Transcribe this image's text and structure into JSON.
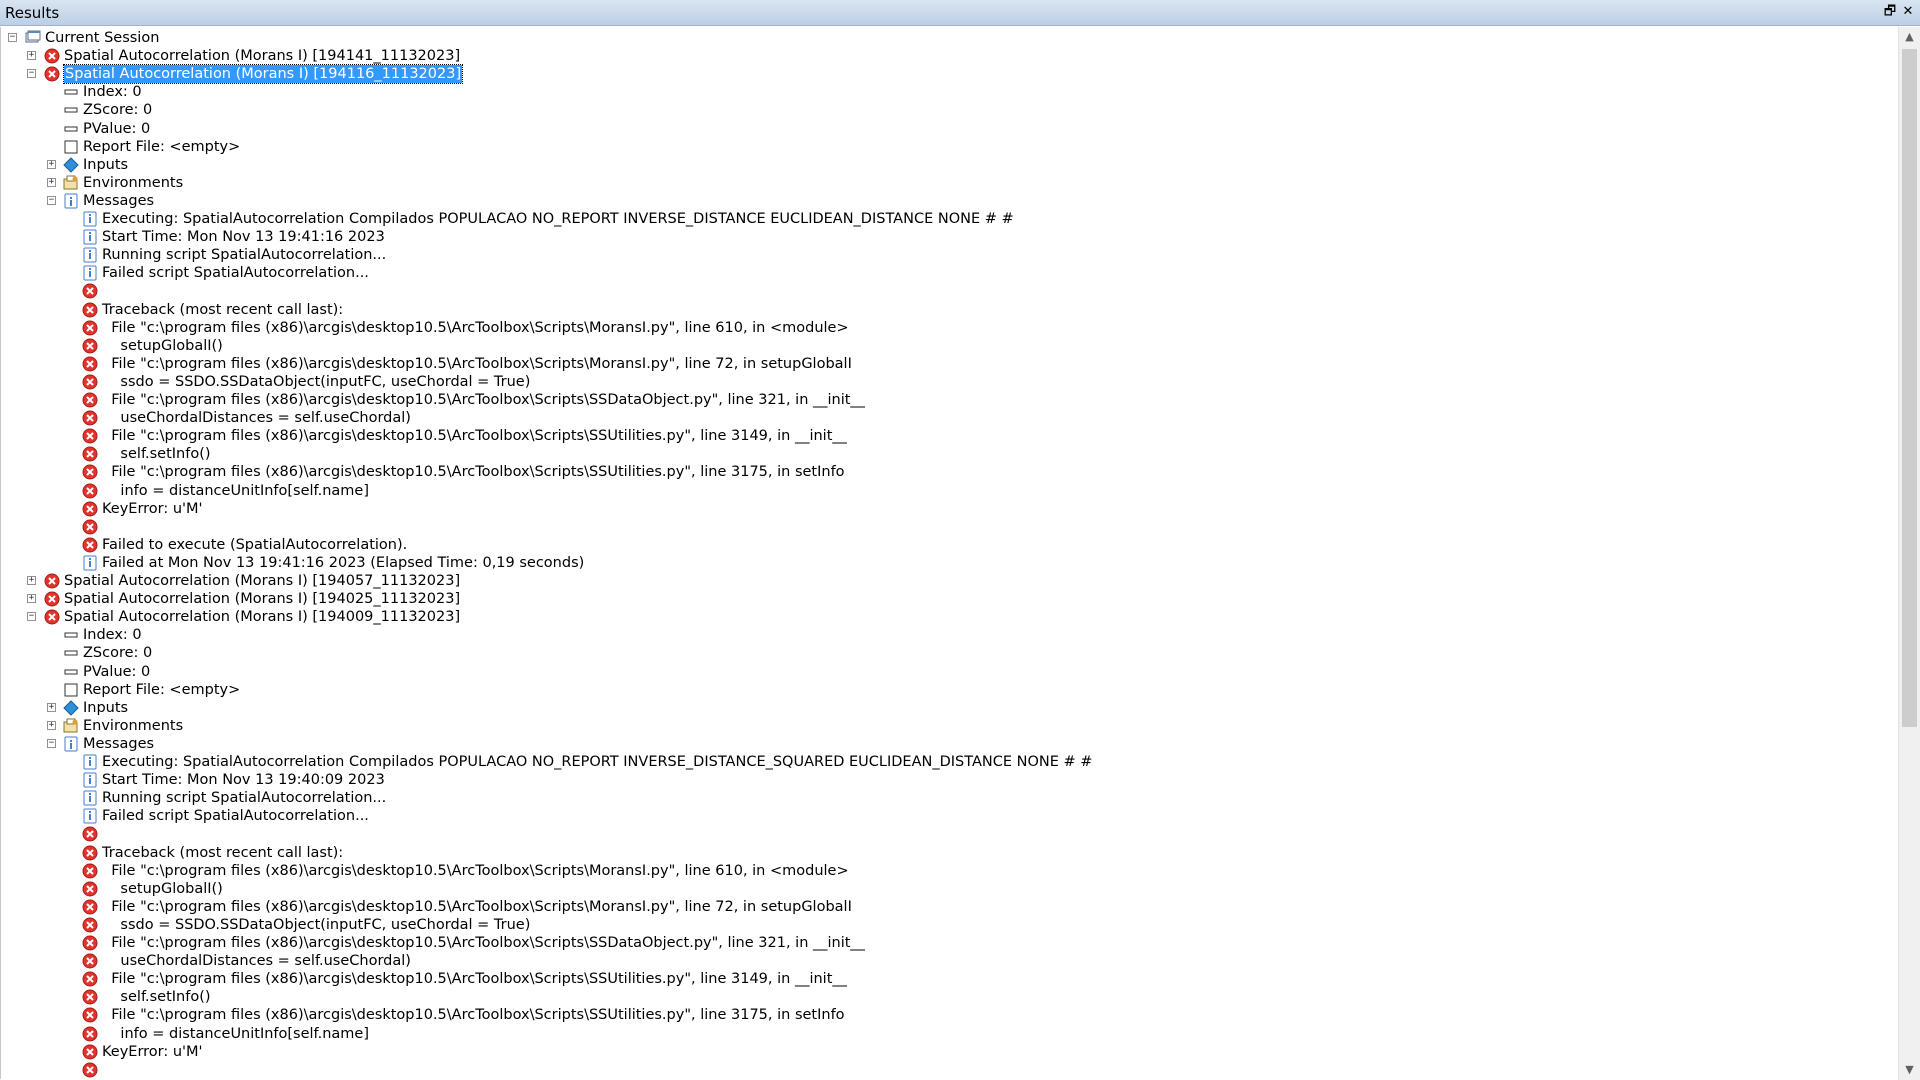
{
  "window": {
    "title": "Results"
  },
  "tree": [
    {
      "text": "Current Session",
      "depth": 0,
      "exp": "-",
      "icon": "session-icon"
    },
    {
      "text": "Spatial Autocorrelation (Morans I) [194141_11132023]",
      "depth": 1,
      "exp": "+",
      "icon": "error-icon"
    },
    {
      "text": "Spatial Autocorrelation (Morans I) [194116_11132023]",
      "depth": 1,
      "exp": "-",
      "icon": "error-icon",
      "selected": true
    },
    {
      "text": "Index: 0",
      "depth": 2,
      "icon": "value-icon"
    },
    {
      "text": "ZScore: 0",
      "depth": 2,
      "icon": "value-icon"
    },
    {
      "text": "PValue: 0",
      "depth": 2,
      "icon": "value-icon"
    },
    {
      "text": "Report File: <empty>",
      "depth": 2,
      "icon": "file-icon"
    },
    {
      "text": "Inputs",
      "depth": 2,
      "exp": "+",
      "icon": "inputs-icon"
    },
    {
      "text": "Environments",
      "depth": 2,
      "exp": "+",
      "icon": "environments-icon"
    },
    {
      "text": "Messages",
      "depth": 2,
      "exp": "-",
      "icon": "messages-icon"
    },
    {
      "text": "Executing: SpatialAutocorrelation Compilados POPULACAO NO_REPORT INVERSE_DISTANCE EUCLIDEAN_DISTANCE NONE # #",
      "depth": 3,
      "icon": "info-icon"
    },
    {
      "text": "Start Time: Mon Nov 13 19:41:16 2023",
      "depth": 3,
      "icon": "info-icon"
    },
    {
      "text": "Running script SpatialAutocorrelation...",
      "depth": 3,
      "icon": "info-icon"
    },
    {
      "text": "Failed script SpatialAutocorrelation...",
      "depth": 3,
      "icon": "info-icon"
    },
    {
      "text": "",
      "depth": 3,
      "icon": "error-icon"
    },
    {
      "text": "Traceback (most recent call last):",
      "depth": 3,
      "icon": "error-icon"
    },
    {
      "text": "  File \"c:\\program files (x86)\\arcgis\\desktop10.5\\ArcToolbox\\Scripts\\MoransI.py\", line 610, in <module>",
      "depth": 3,
      "icon": "error-icon"
    },
    {
      "text": "    setupGlobalI()",
      "depth": 3,
      "icon": "error-icon"
    },
    {
      "text": "  File \"c:\\program files (x86)\\arcgis\\desktop10.5\\ArcToolbox\\Scripts\\MoransI.py\", line 72, in setupGlobalI",
      "depth": 3,
      "icon": "error-icon"
    },
    {
      "text": "    ssdo = SSDO.SSDataObject(inputFC, useChordal = True)",
      "depth": 3,
      "icon": "error-icon"
    },
    {
      "text": "  File \"c:\\program files (x86)\\arcgis\\desktop10.5\\ArcToolbox\\Scripts\\SSDataObject.py\", line 321, in __init__",
      "depth": 3,
      "icon": "error-icon"
    },
    {
      "text": "    useChordalDistances = self.useChordal)",
      "depth": 3,
      "icon": "error-icon"
    },
    {
      "text": "  File \"c:\\program files (x86)\\arcgis\\desktop10.5\\ArcToolbox\\Scripts\\SSUtilities.py\", line 3149, in __init__",
      "depth": 3,
      "icon": "error-icon"
    },
    {
      "text": "    self.setInfo()",
      "depth": 3,
      "icon": "error-icon"
    },
    {
      "text": "  File \"c:\\program files (x86)\\arcgis\\desktop10.5\\ArcToolbox\\Scripts\\SSUtilities.py\", line 3175, in setInfo",
      "depth": 3,
      "icon": "error-icon"
    },
    {
      "text": "    info = distanceUnitInfo[self.name]",
      "depth": 3,
      "icon": "error-icon"
    },
    {
      "text": "KeyError: u'M'",
      "depth": 3,
      "icon": "error-icon"
    },
    {
      "text": "",
      "depth": 3,
      "icon": "error-icon"
    },
    {
      "text": "Failed to execute (SpatialAutocorrelation).",
      "depth": 3,
      "icon": "error-icon"
    },
    {
      "text": "Failed at Mon Nov 13 19:41:16 2023 (Elapsed Time: 0,19 seconds)",
      "depth": 3,
      "icon": "info-icon"
    },
    {
      "text": "Spatial Autocorrelation (Morans I) [194057_11132023]",
      "depth": 1,
      "exp": "+",
      "icon": "error-icon"
    },
    {
      "text": "Spatial Autocorrelation (Morans I) [194025_11132023]",
      "depth": 1,
      "exp": "+",
      "icon": "error-icon"
    },
    {
      "text": "Spatial Autocorrelation (Morans I) [194009_11132023]",
      "depth": 1,
      "exp": "-",
      "icon": "error-icon"
    },
    {
      "text": "Index: 0",
      "depth": 2,
      "icon": "value-icon"
    },
    {
      "text": "ZScore: 0",
      "depth": 2,
      "icon": "value-icon"
    },
    {
      "text": "PValue: 0",
      "depth": 2,
      "icon": "value-icon"
    },
    {
      "text": "Report File: <empty>",
      "depth": 2,
      "icon": "file-icon"
    },
    {
      "text": "Inputs",
      "depth": 2,
      "exp": "+",
      "icon": "inputs-icon"
    },
    {
      "text": "Environments",
      "depth": 2,
      "exp": "+",
      "icon": "environments-icon"
    },
    {
      "text": "Messages",
      "depth": 2,
      "exp": "-",
      "icon": "messages-icon"
    },
    {
      "text": "Executing: SpatialAutocorrelation Compilados POPULACAO NO_REPORT INVERSE_DISTANCE_SQUARED EUCLIDEAN_DISTANCE NONE # #",
      "depth": 3,
      "icon": "info-icon"
    },
    {
      "text": "Start Time: Mon Nov 13 19:40:09 2023",
      "depth": 3,
      "icon": "info-icon"
    },
    {
      "text": "Running script SpatialAutocorrelation...",
      "depth": 3,
      "icon": "info-icon"
    },
    {
      "text": "Failed script SpatialAutocorrelation...",
      "depth": 3,
      "icon": "info-icon"
    },
    {
      "text": "",
      "depth": 3,
      "icon": "error-icon"
    },
    {
      "text": "Traceback (most recent call last):",
      "depth": 3,
      "icon": "error-icon"
    },
    {
      "text": "  File \"c:\\program files (x86)\\arcgis\\desktop10.5\\ArcToolbox\\Scripts\\MoransI.py\", line 610, in <module>",
      "depth": 3,
      "icon": "error-icon"
    },
    {
      "text": "    setupGlobalI()",
      "depth": 3,
      "icon": "error-icon"
    },
    {
      "text": "  File \"c:\\program files (x86)\\arcgis\\desktop10.5\\ArcToolbox\\Scripts\\MoransI.py\", line 72, in setupGlobalI",
      "depth": 3,
      "icon": "error-icon"
    },
    {
      "text": "    ssdo = SSDO.SSDataObject(inputFC, useChordal = True)",
      "depth": 3,
      "icon": "error-icon"
    },
    {
      "text": "  File \"c:\\program files (x86)\\arcgis\\desktop10.5\\ArcToolbox\\Scripts\\SSDataObject.py\", line 321, in __init__",
      "depth": 3,
      "icon": "error-icon"
    },
    {
      "text": "    useChordalDistances = self.useChordal)",
      "depth": 3,
      "icon": "error-icon"
    },
    {
      "text": "  File \"c:\\program files (x86)\\arcgis\\desktop10.5\\ArcToolbox\\Scripts\\SSUtilities.py\", line 3149, in __init__",
      "depth": 3,
      "icon": "error-icon"
    },
    {
      "text": "    self.setInfo()",
      "depth": 3,
      "icon": "error-icon"
    },
    {
      "text": "  File \"c:\\program files (x86)\\arcgis\\desktop10.5\\ArcToolbox\\Scripts\\SSUtilities.py\", line 3175, in setInfo",
      "depth": 3,
      "icon": "error-icon"
    },
    {
      "text": "    info = distanceUnitInfo[self.name]",
      "depth": 3,
      "icon": "error-icon"
    },
    {
      "text": "KeyError: u'M'",
      "depth": 3,
      "icon": "error-icon"
    },
    {
      "text": "",
      "depth": 3,
      "icon": "error-icon"
    }
  ],
  "colors": {
    "selection": "#3399ff",
    "error": "#e0342d",
    "info": "#3f7ed6",
    "titlebar": "#c9d8ea"
  }
}
